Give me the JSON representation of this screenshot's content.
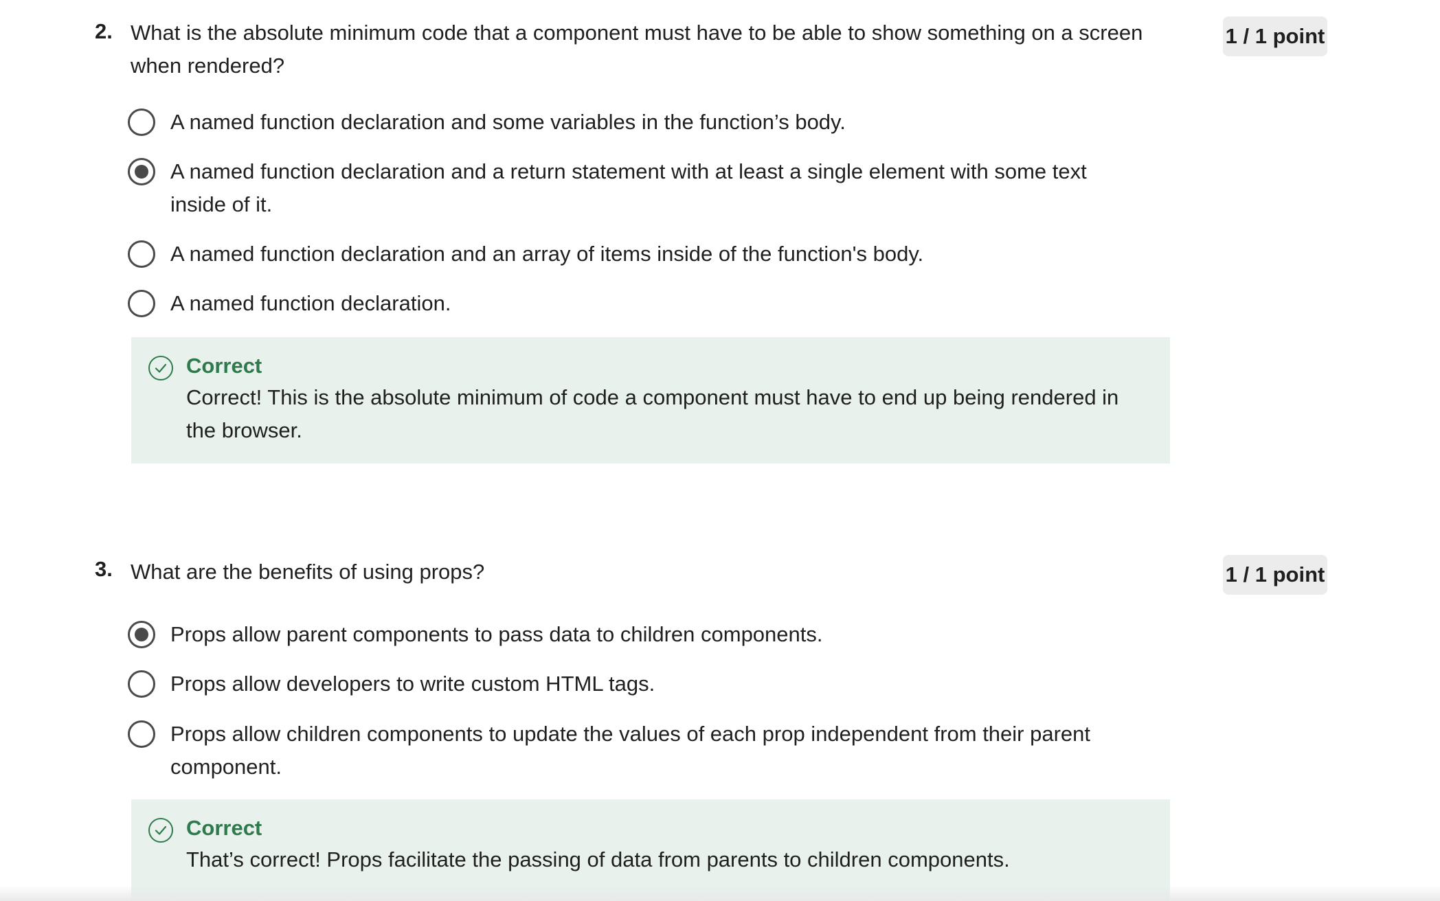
{
  "questions": [
    {
      "number": "2.",
      "text": "What is the absolute minimum code that a component must have to be able to show something on a screen when rendered?",
      "points": "1 / 1 point",
      "options": [
        {
          "label": "A named function declaration and some variables in the function’s body.",
          "selected": false
        },
        {
          "label": "A named function declaration and a return statement with at least a single element with some text inside of it.",
          "selected": true
        },
        {
          "label": "A named function declaration and an array of items inside of the function's body.",
          "selected": false
        },
        {
          "label": "A named function declaration.",
          "selected": false
        }
      ],
      "feedback": {
        "title": "Correct",
        "text": "Correct! This is the absolute minimum of code a component must have to end up being rendered in the browser."
      }
    },
    {
      "number": "3.",
      "text": "What are the benefits of using props?",
      "points": "1 / 1 point",
      "options": [
        {
          "label": "Props allow parent components to pass data to children components.",
          "selected": true
        },
        {
          "label": "Props allow developers to write custom HTML tags.",
          "selected": false
        },
        {
          "label": "Props allow children components to update the values of each prop independent from their parent component.",
          "selected": false
        }
      ],
      "feedback": {
        "title": "Correct",
        "text": "That’s correct! Props facilitate the passing of data from parents to children components."
      }
    }
  ],
  "colors": {
    "feedback_bg": "#e8f1ec",
    "correct_green": "#2f7a4d",
    "badge_bg": "#ececec",
    "radio": "#4a4a4a"
  }
}
